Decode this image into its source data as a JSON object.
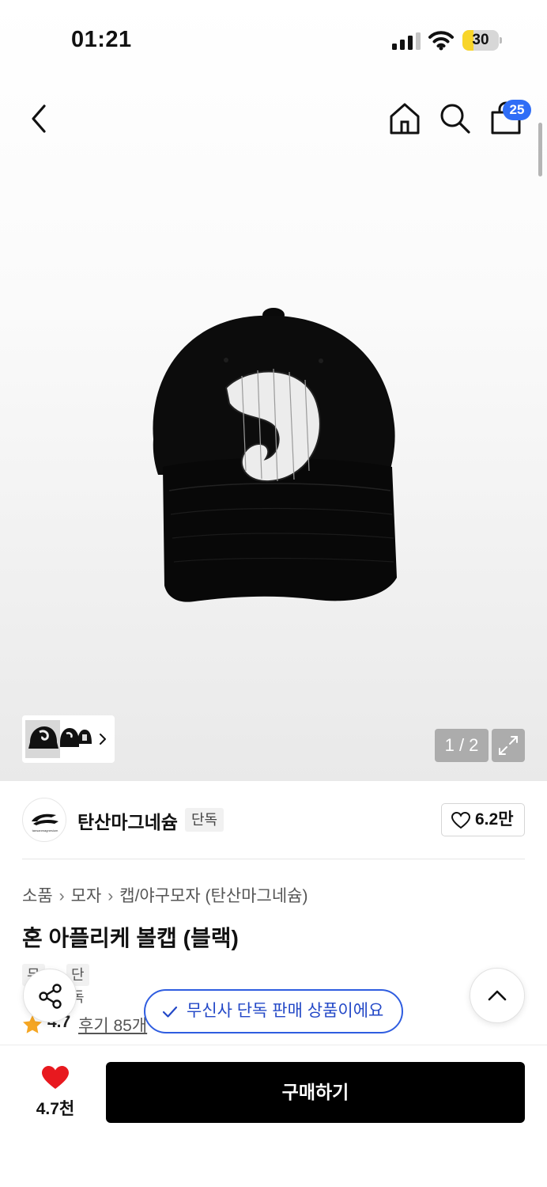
{
  "status_bar": {
    "time": "01:21",
    "battery_level": "30",
    "battery_fraction": 0.3,
    "icons": [
      "signal-icon",
      "wifi-icon",
      "battery-icon"
    ]
  },
  "header": {
    "icons": [
      "back-icon",
      "home-icon",
      "search-icon",
      "cart-icon"
    ],
    "cart_count": "25"
  },
  "gallery": {
    "counter": "1 / 2",
    "icons": [
      "chevron-right-icon",
      "expand-icon"
    ]
  },
  "brand": {
    "name": "탄산마그네슘",
    "tag": "단독",
    "likes": "6.2만",
    "logo_text": "tansanmagnesium"
  },
  "breadcrumb": {
    "items": [
      "소품",
      "모자",
      "캡/야구모자 (탄산마그네슘)"
    ]
  },
  "product": {
    "title": "혼 아플리케 볼캡 (블랙)",
    "badges": [
      "무",
      "단독"
    ],
    "rating": "4.7",
    "reviews": "후기 85개"
  },
  "toast": {
    "text": "무신사 단독 판매 상품이에요"
  },
  "bottom_bar": {
    "wish_count": "4.7천",
    "buy_label": "구매하기"
  },
  "colors": {
    "accent_blue": "#2f6df6",
    "toast_blue": "#2f5de0",
    "heart_red": "#e8191f",
    "star_orange": "#f5a623",
    "battery_yellow": "#f8d52a"
  }
}
